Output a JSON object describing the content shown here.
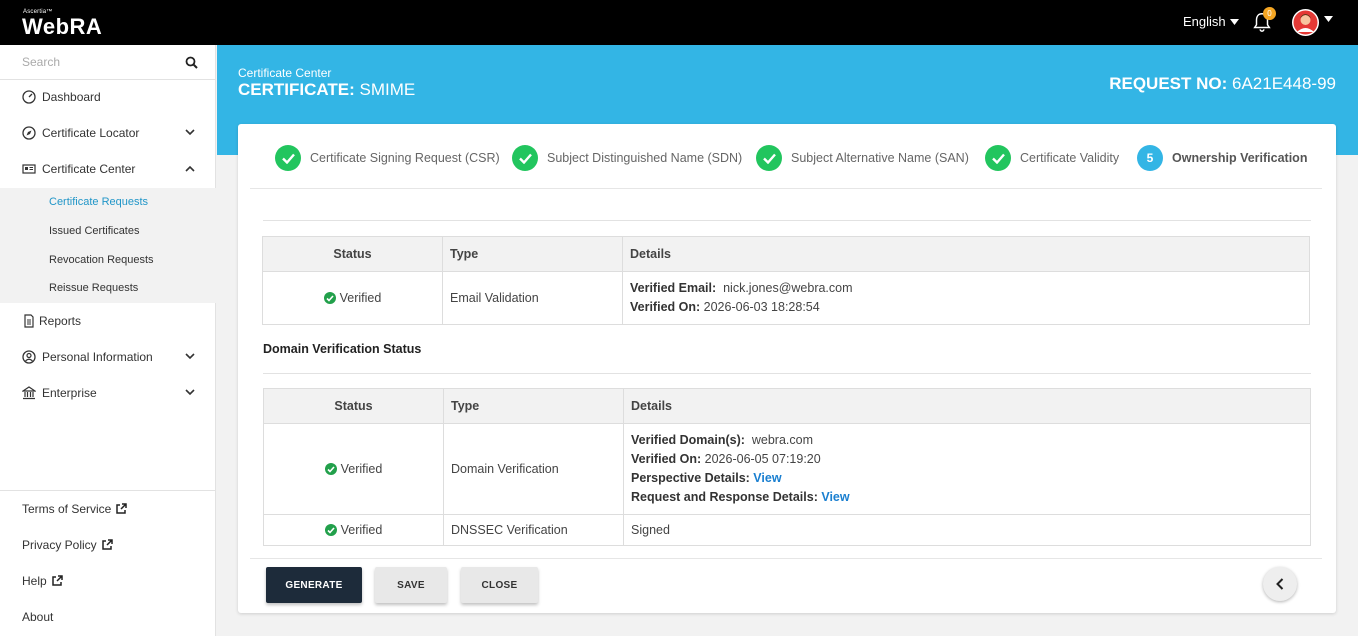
{
  "topbar": {
    "brand_small": "Ascertia™",
    "brand": "WebRA",
    "language": "English",
    "notification_count": "0"
  },
  "sidebar": {
    "search_placeholder": "Search",
    "items": [
      {
        "label": "Dashboard",
        "icon": "dashboard-icon"
      },
      {
        "label": "Certificate Locator",
        "icon": "compass-icon"
      },
      {
        "label": "Certificate Center",
        "icon": "id-card-icon"
      }
    ],
    "submenu": [
      {
        "label": "Certificate Requests",
        "active": true
      },
      {
        "label": "Issued Certificates"
      },
      {
        "label": "Revocation Requests"
      },
      {
        "label": "Reissue Requests"
      }
    ],
    "items2": [
      {
        "label": "Reports",
        "icon": "document-icon"
      },
      {
        "label": "Personal Information",
        "icon": "user-circle-icon"
      },
      {
        "label": "Enterprise",
        "icon": "bank-icon"
      }
    ],
    "footer": [
      {
        "label": "Terms of Service"
      },
      {
        "label": "Privacy Policy"
      },
      {
        "label": "Help"
      },
      {
        "label": "About"
      }
    ]
  },
  "header": {
    "breadcrumb": "Certificate Center",
    "title_prefix": "CERTIFICATE:",
    "title_value": "SMIME",
    "request_label": "REQUEST NO:",
    "request_value": "6A21E448-99"
  },
  "steps": [
    {
      "label": "Certificate Signing Request (CSR)",
      "done": true
    },
    {
      "label": "Subject Distinguished Name (SDN)",
      "done": true
    },
    {
      "label": "Subject Alternative Name (SAN)",
      "done": true
    },
    {
      "label": "Certificate Validity",
      "done": true
    },
    {
      "label": "Ownership Verification",
      "number": "5",
      "done": false
    }
  ],
  "email_table": {
    "headers": [
      "Status",
      "Type",
      "Details"
    ],
    "row": {
      "status": "Verified",
      "type": "Email Validation",
      "email_label": "Verified Email:",
      "email_value": "nick.jones@webra.com",
      "on_label": "Verified On:",
      "on_value": "2026-06-03 18:28:54"
    }
  },
  "domain_section_title": "Domain Verification Status",
  "domain_table": {
    "headers": [
      "Status",
      "Type",
      "Details"
    ],
    "rows": [
      {
        "status": "Verified",
        "type": "Domain Verification",
        "domains_label": "Verified Domain(s):",
        "domains_value": "webra.com",
        "on_label": "Verified On:",
        "on_value": "2026-06-05 07:19:20",
        "perspective_label": "Perspective Details:",
        "perspective_link": "View",
        "reqres_label": "Request and Response Details:",
        "reqres_link": "View"
      },
      {
        "status": "Verified",
        "type": "DNSSEC Verification",
        "details": "Signed"
      }
    ]
  },
  "buttons": {
    "generate": "GENERATE",
    "save": "SAVE",
    "close": "CLOSE"
  },
  "colors": {
    "header_blue": "#33b5e5",
    "success_green": "#22c55e",
    "primary_dark": "#1d2b3a",
    "link_blue": "#1a7fd0"
  }
}
